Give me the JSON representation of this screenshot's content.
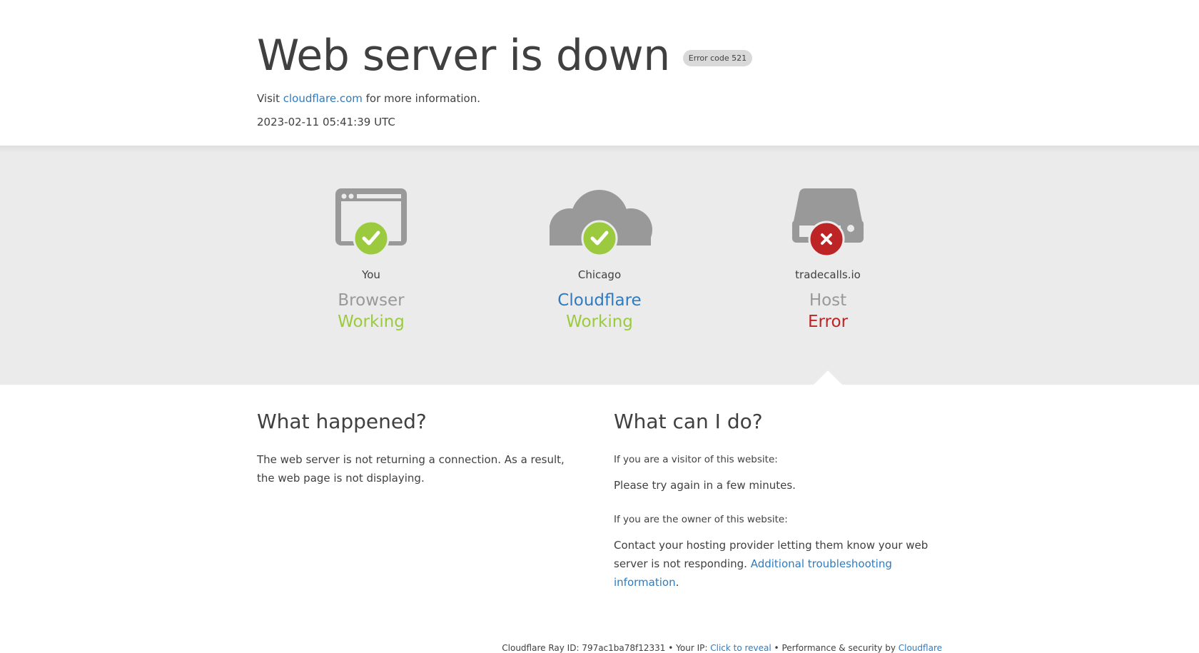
{
  "header": {
    "title": "Web server is down",
    "error_badge": "Error code 521",
    "visit_prefix": "Visit ",
    "visit_link": "cloudflare.com",
    "visit_suffix": " for more information.",
    "timestamp": "2023-02-11 05:41:39 UTC"
  },
  "status": {
    "browser": {
      "location": "You",
      "role": "Browser",
      "state": "Working",
      "icon": "browser-icon",
      "indicator": "check-icon"
    },
    "cloudflare": {
      "location": "Chicago",
      "role": "Cloudflare",
      "state": "Working",
      "icon": "cloud-icon",
      "indicator": "check-icon"
    },
    "host": {
      "location": "tradecalls.io",
      "role": "Host",
      "state": "Error",
      "icon": "server-icon",
      "indicator": "x-icon"
    }
  },
  "what_happened": {
    "heading": "What happened?",
    "body": "The web server is not returning a connection. As a result, the web page is not displaying."
  },
  "what_can_i_do": {
    "heading": "What can I do?",
    "visitor_label": "If you are a visitor of this website:",
    "visitor_text": "Please try again in a few minutes.",
    "owner_label": "If you are the owner of this website:",
    "owner_text": "Contact your hosting provider letting them know your web server is not responding.",
    "owner_link": "Additional troubleshooting information",
    "owner_suffix": "."
  },
  "footer": {
    "ray_id": "Cloudflare Ray ID: 797ac1ba78f12331",
    "sep1": " • ",
    "ip_prefix": "Your IP: ",
    "ip_link": "Click to reveal",
    "sep2": " • ",
    "perf_prefix": "Performance & security by ",
    "perf_link": "Cloudflare"
  },
  "colors": {
    "ok": "#9bca3e",
    "error": "#bd2426",
    "link": "#2f7bbf",
    "icon_gray": "#999999",
    "band_bg": "#ebebeb"
  }
}
